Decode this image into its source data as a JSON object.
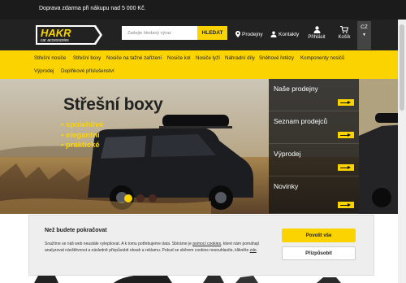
{
  "topbar": {
    "text": "Doprava zdarma při nákupu nad 5 000 Kč."
  },
  "header": {
    "logo": {
      "name": "HAKR",
      "tagline": "car accessories"
    },
    "search": {
      "placeholder": "Zadejte hledaný výraz",
      "button_label": "HLEDAT"
    },
    "links": {
      "stores": "Prodejny",
      "contacts": "Kontakty",
      "login": "Přihlásit",
      "cart": "Košík"
    },
    "language": "CZ"
  },
  "nav": {
    "items": [
      "Střešní nosiče",
      "Střešní boxy",
      "Nosiče na tažné zařízení",
      "Nosiče kol",
      "Nosiče lyží",
      "Náhradní díly",
      "Sněhové řetězy",
      "Komponenty nosičů",
      "Výprodej",
      "Doplňkové příslušenství"
    ]
  },
  "hero": {
    "title": "Střešní boxy",
    "bullets": [
      "spolehlivé",
      "elegantní",
      "praktické"
    ],
    "slider": {
      "count": 3,
      "active": 0
    }
  },
  "side_panel": {
    "items": [
      "Naše prodejny",
      "Seznam prodejců",
      "Výprodej",
      "Novinky"
    ]
  },
  "cookie": {
    "title": "Než budete pokračovat",
    "text_1": "Snažíme se náš web neustále vylepšovat. A k tomu potřebujeme data. Sbíráme je ",
    "link_1": "pomocí cookies",
    "text_2": ", které nám pomáhají analyzovat návštěvnost a následně přizpůsobit obsah a reklamu. Pokud se sběrem cookies nesouhlasíte, klikněte ",
    "link_2": "zde",
    "text_3": ".",
    "allow_button": "Povolit vše",
    "customize_button": "Přizpůsobit"
  },
  "colors": {
    "accent": "#fbd400",
    "dark": "#222222",
    "topbar": "#1b1b1b"
  }
}
